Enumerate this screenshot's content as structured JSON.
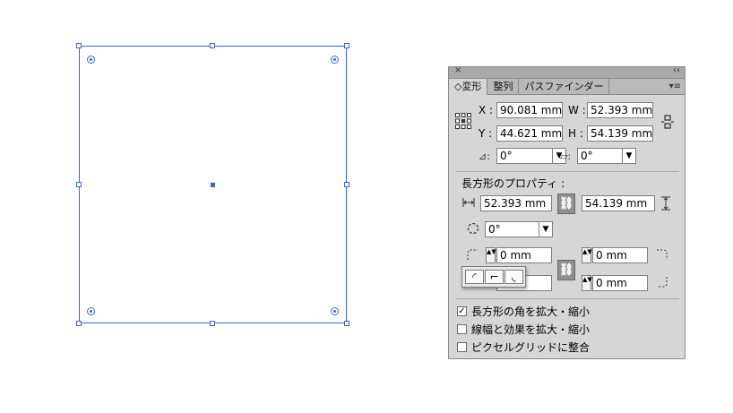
{
  "panel": {
    "close_glyph": "×",
    "collapse_glyph": "‹‹",
    "tabs": [
      {
        "label": "◇変形"
      },
      {
        "label": "整列"
      },
      {
        "label": "パスファインダー"
      }
    ],
    "menu_glyph": "▾≡",
    "x_label": "X :",
    "x_value": "90.081 mm",
    "y_label": "Y :",
    "y_value": "44.621 mm",
    "w_label": "W :",
    "w_value": "52.393 mm",
    "h_label": "H :",
    "h_value": "54.139 mm",
    "rotate_icon": "⊿:",
    "rotate_value": "0°",
    "shear_icon": "▱:",
    "shear_value": "0°",
    "rect_props_title": "長方形のプロパティ :",
    "rect_w_value": "52.393 mm",
    "rect_h_value": "54.139 mm",
    "rect_rotate_value": "0°",
    "corner_tl": "0 mm",
    "corner_tr": "0 mm",
    "corner_bl": "mm",
    "corner_br": "0 mm",
    "checkboxes": [
      {
        "label": "長方形の角を拡大・縮小",
        "checked": true
      },
      {
        "label": "線幅と効果を拡大・縮小",
        "checked": false
      },
      {
        "label": "ピクセルグリッドに整合",
        "checked": false
      }
    ],
    "check_glyph": "✓",
    "dropdown_arrow": "▼",
    "stepper_glyph": "▲▼",
    "chain_glyph": "⛓",
    "corner_styles": [
      "◜",
      "⌐",
      "◟"
    ]
  }
}
